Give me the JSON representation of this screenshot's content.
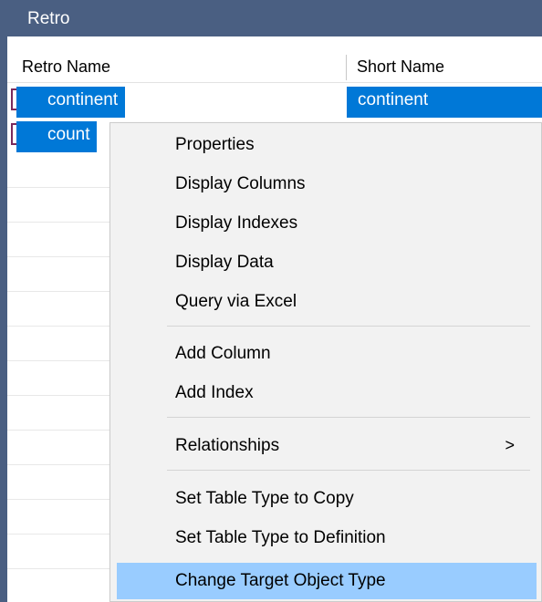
{
  "panel": {
    "title": "Retro",
    "columns": [
      "Retro Name",
      "Short Name"
    ],
    "rows": [
      {
        "name": "continent",
        "short": "continent"
      },
      {
        "name": "count",
        "short": ""
      }
    ]
  },
  "context_menu": {
    "items": [
      {
        "label": "Properties"
      },
      {
        "label": "Display Columns"
      },
      {
        "label": "Display Indexes"
      },
      {
        "label": "Display Data"
      },
      {
        "label": "Query via Excel"
      },
      {
        "label": "Add Column"
      },
      {
        "label": "Add Index"
      },
      {
        "label": "Relationships",
        "submenu_arrow": ">"
      },
      {
        "label": "Set Table Type to Copy"
      },
      {
        "label": "Set Table Type to Definition"
      },
      {
        "label": "Change Target Object Type",
        "highlighted": true
      }
    ]
  },
  "colors": {
    "title_bar": "#4a5f82",
    "selection": "#0078d7",
    "menu_highlight": "#99ccff",
    "menu_background": "#f2f2f2"
  }
}
